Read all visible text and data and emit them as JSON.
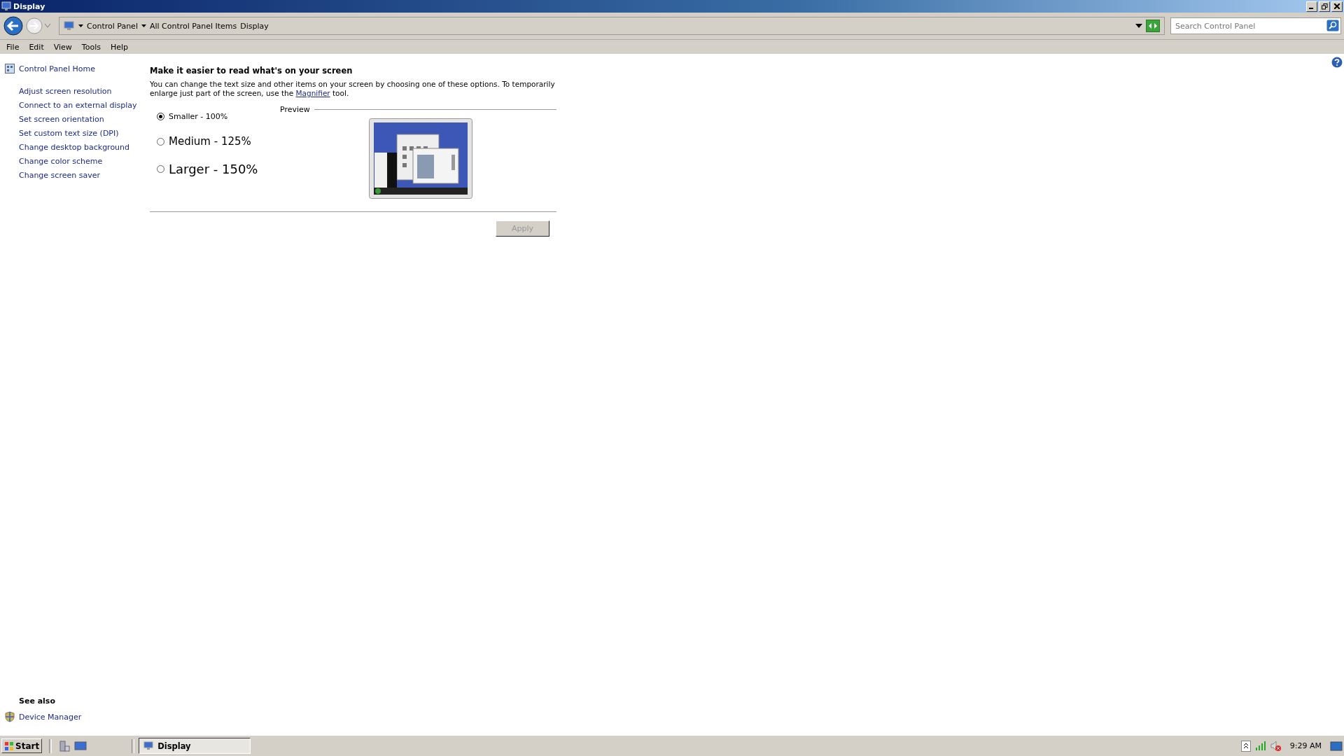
{
  "window": {
    "title": "Display"
  },
  "address_bar": {
    "breadcrumbs": [
      "Control Panel",
      "All Control Panel Items",
      "Display"
    ]
  },
  "search": {
    "placeholder": "Search Control Panel"
  },
  "menu": [
    "File",
    "Edit",
    "View",
    "Tools",
    "Help"
  ],
  "sidebar": {
    "home": "Control Panel Home",
    "links": [
      "Adjust screen resolution",
      "Connect to an external display",
      "Set screen orientation",
      "Set custom text size (DPI)",
      "Change desktop background",
      "Change color scheme",
      "Change screen saver"
    ]
  },
  "main": {
    "heading": "Make it easier to read what's on your screen",
    "description": {
      "before": "You can change the text size and other items on your screen by choosing one of these options. To temporarily enlarge just part of the screen, use the",
      "link": "Magnifier",
      "after": "tool."
    },
    "options": [
      {
        "label": "Smaller - 100%",
        "selected": true
      },
      {
        "label": "Medium - 125%",
        "selected": false
      },
      {
        "label": "Larger - 150%",
        "selected": false
      }
    ],
    "preview_label": "Preview",
    "apply": {
      "label": "Apply",
      "disabled": true
    }
  },
  "see_also": {
    "title": "See also",
    "items": [
      "Device Manager"
    ]
  },
  "taskbar": {
    "start": "Start",
    "tasks": [
      {
        "label": "Display",
        "selected": true
      }
    ],
    "clock": "9:29 AM"
  }
}
